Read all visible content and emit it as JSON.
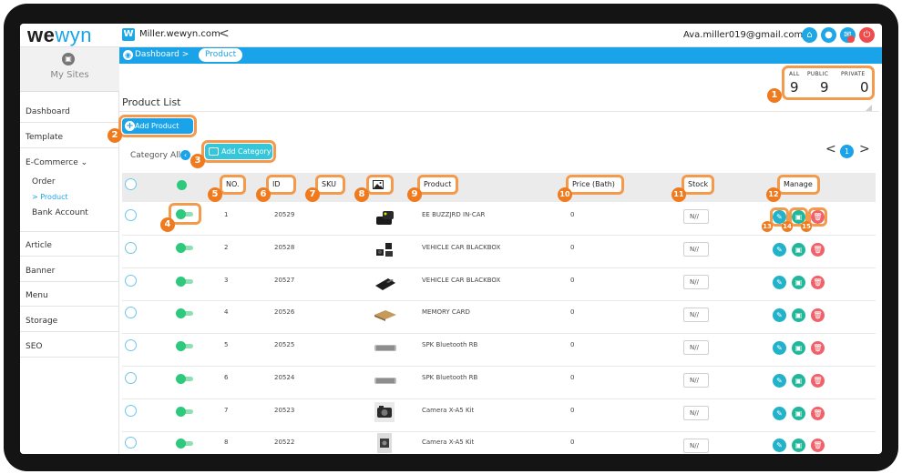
{
  "app": {
    "logo_we": "we",
    "logo_yn": "wyn",
    "site_badge": "W",
    "site_name": "Miller.wewyn.com",
    "collapse": "<",
    "user_email": "Ava.miller019@gmail.com"
  },
  "sidebar": {
    "my_sites": "My Sites",
    "items": [
      {
        "label": "Dashboard"
      },
      {
        "label": "Template"
      },
      {
        "label": "E-Commerce ⌄"
      },
      {
        "label": "Article"
      },
      {
        "label": "Banner"
      },
      {
        "label": "Menu"
      },
      {
        "label": "Storage"
      },
      {
        "label": "SEO"
      }
    ],
    "ecommerce_children": [
      {
        "label": "Order"
      },
      {
        "label": "> Product"
      },
      {
        "label": "Bank Account"
      }
    ]
  },
  "breadcrumb": {
    "root": "Dashboard >",
    "current": "Product"
  },
  "counts": {
    "all_label": "ALL",
    "all_value": "9",
    "public_label": "PUBLIC",
    "public_value": "9",
    "private_label": "PRIVATE",
    "private_value": "0"
  },
  "panel": {
    "title": "Product List",
    "add_product": "Add Product",
    "category_filter": "Category All",
    "add_category": "Add Category",
    "pager_prev": "<",
    "pager_page": "1",
    "pager_next": ">"
  },
  "table": {
    "headers": {
      "no": "NO.",
      "id": "ID",
      "sku": "SKU",
      "image": "image-icon",
      "product": "Product",
      "price": "Price (Bath)",
      "stock": "Stock",
      "manage": "Manage"
    },
    "rows": [
      {
        "no": "1",
        "id": "20529",
        "product": "EE BUZZJRD IN-CAR",
        "price": "0",
        "stock": "N//",
        "thumb": "car-charger"
      },
      {
        "no": "2",
        "id": "20528",
        "product": "VEHICLE CAR BLACKBOX",
        "price": "0",
        "stock": "N//",
        "thumb": "dash-camera"
      },
      {
        "no": "3",
        "id": "20527",
        "product": "VEHICLE CAR BLACKBOX",
        "price": "0",
        "stock": "N//",
        "thumb": "memory-card-black"
      },
      {
        "no": "4",
        "id": "20526",
        "product": "MEMORY CARD",
        "price": "0",
        "stock": "N//",
        "thumb": "memory-card-gold"
      },
      {
        "no": "5",
        "id": "20525",
        "product": "SPK Bluetooth RB",
        "price": "0",
        "stock": "N//",
        "thumb": "bluetooth-speaker"
      },
      {
        "no": "6",
        "id": "20524",
        "product": "SPK Bluetooth RB",
        "price": "0",
        "stock": "N//",
        "thumb": "bluetooth-speaker"
      },
      {
        "no": "7",
        "id": "20523",
        "product": "Camera X-A5 Kit",
        "price": "0",
        "stock": "N//",
        "thumb": "camera-kit"
      },
      {
        "no": "8",
        "id": "20522",
        "product": "Camera X-A5 Kit",
        "price": "0",
        "stock": "N//",
        "thumb": "camera-box"
      }
    ]
  },
  "markers": [
    "1",
    "2",
    "3",
    "4",
    "5",
    "6",
    "7",
    "8",
    "9",
    "10",
    "11",
    "12",
    "13",
    "14",
    "15"
  ],
  "colors": {
    "accent": "#1aa3e8",
    "annotation": "#f07a1e",
    "toggle_on": "#2dc97c",
    "delete": "#f0626a",
    "add_category": "#35c7d9"
  }
}
